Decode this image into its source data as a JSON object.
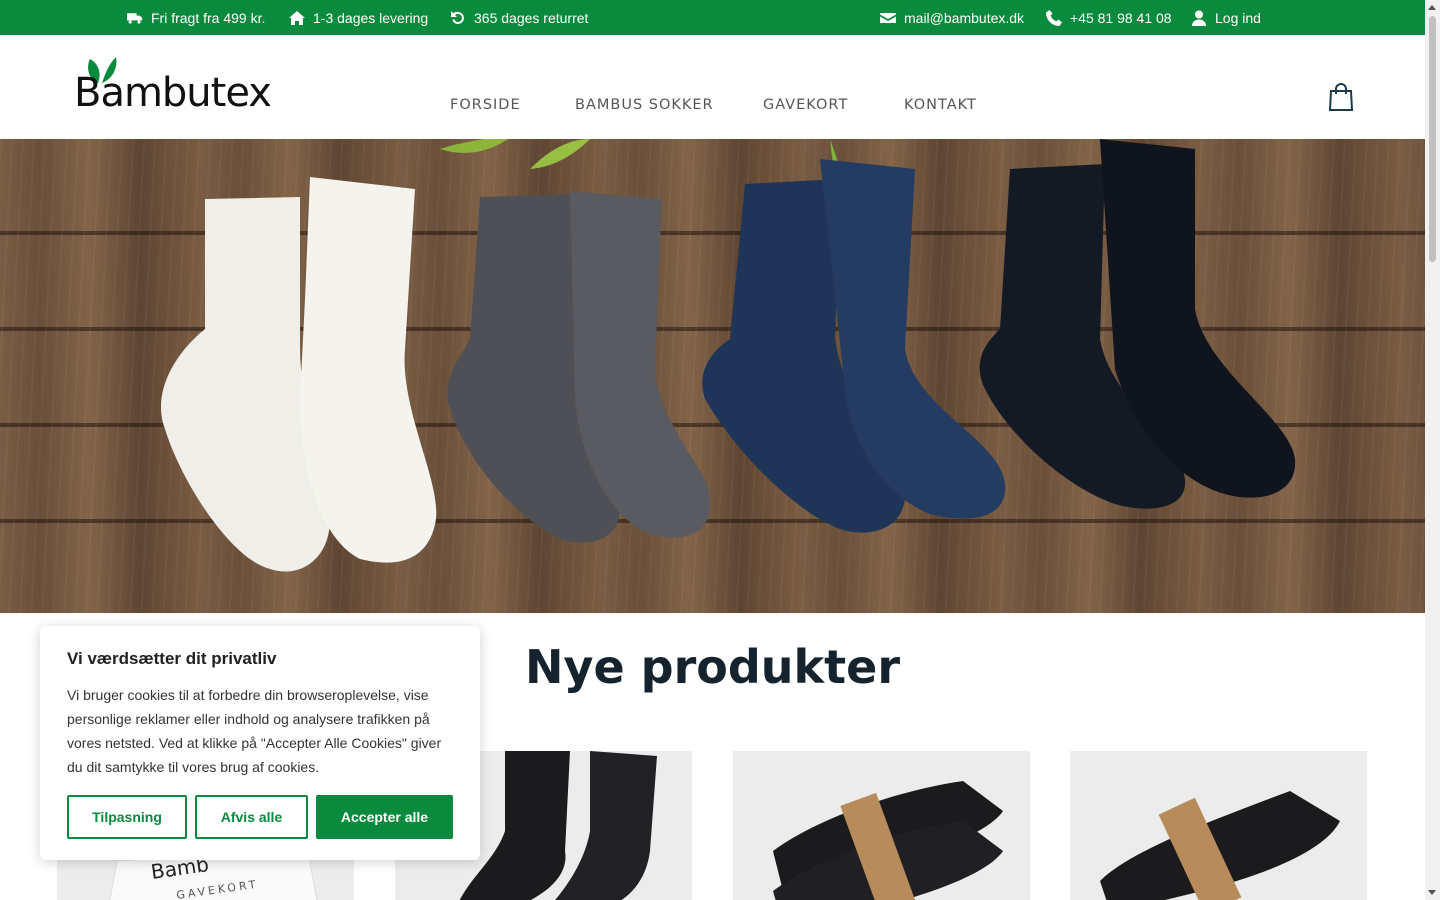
{
  "topbar": {
    "shipping": "Fri fragt fra 499 kr.",
    "delivery": "1-3 dages levering",
    "returns": "365 dages returret",
    "email": "mail@bambutex.dk",
    "phone": "+45 81 98 41 08",
    "login": "Log ind"
  },
  "header": {
    "logo_text": "Bambutex",
    "nav": [
      "FORSIDE",
      "BAMBUS SOKKER",
      "GAVEKORT",
      "KONTAKT"
    ]
  },
  "section": {
    "title": "Nye produkter"
  },
  "cookie": {
    "title": "Vi værdsætter dit privatliv",
    "body": "Vi bruger cookies til at forbedre din browseroplevelse, vise personlige reklamer eller indhold og analysere trafikken på vores netsted. Ved at klikke på \"Accepter Alle Cookies\" giver du dit samtykke til vores brug af cookies.",
    "btn_customize": "Tilpasning",
    "btn_reject": "Afvis alle",
    "btn_accept": "Accepter alle"
  },
  "products": [
    {
      "image": "gavekort"
    },
    {
      "image": "black-sock"
    },
    {
      "image": "black-socks-pack"
    },
    {
      "image": "black-ankle-socks-pack"
    }
  ],
  "colors": {
    "brand_green": "#0a8a3c",
    "title_dark": "#14232e"
  }
}
